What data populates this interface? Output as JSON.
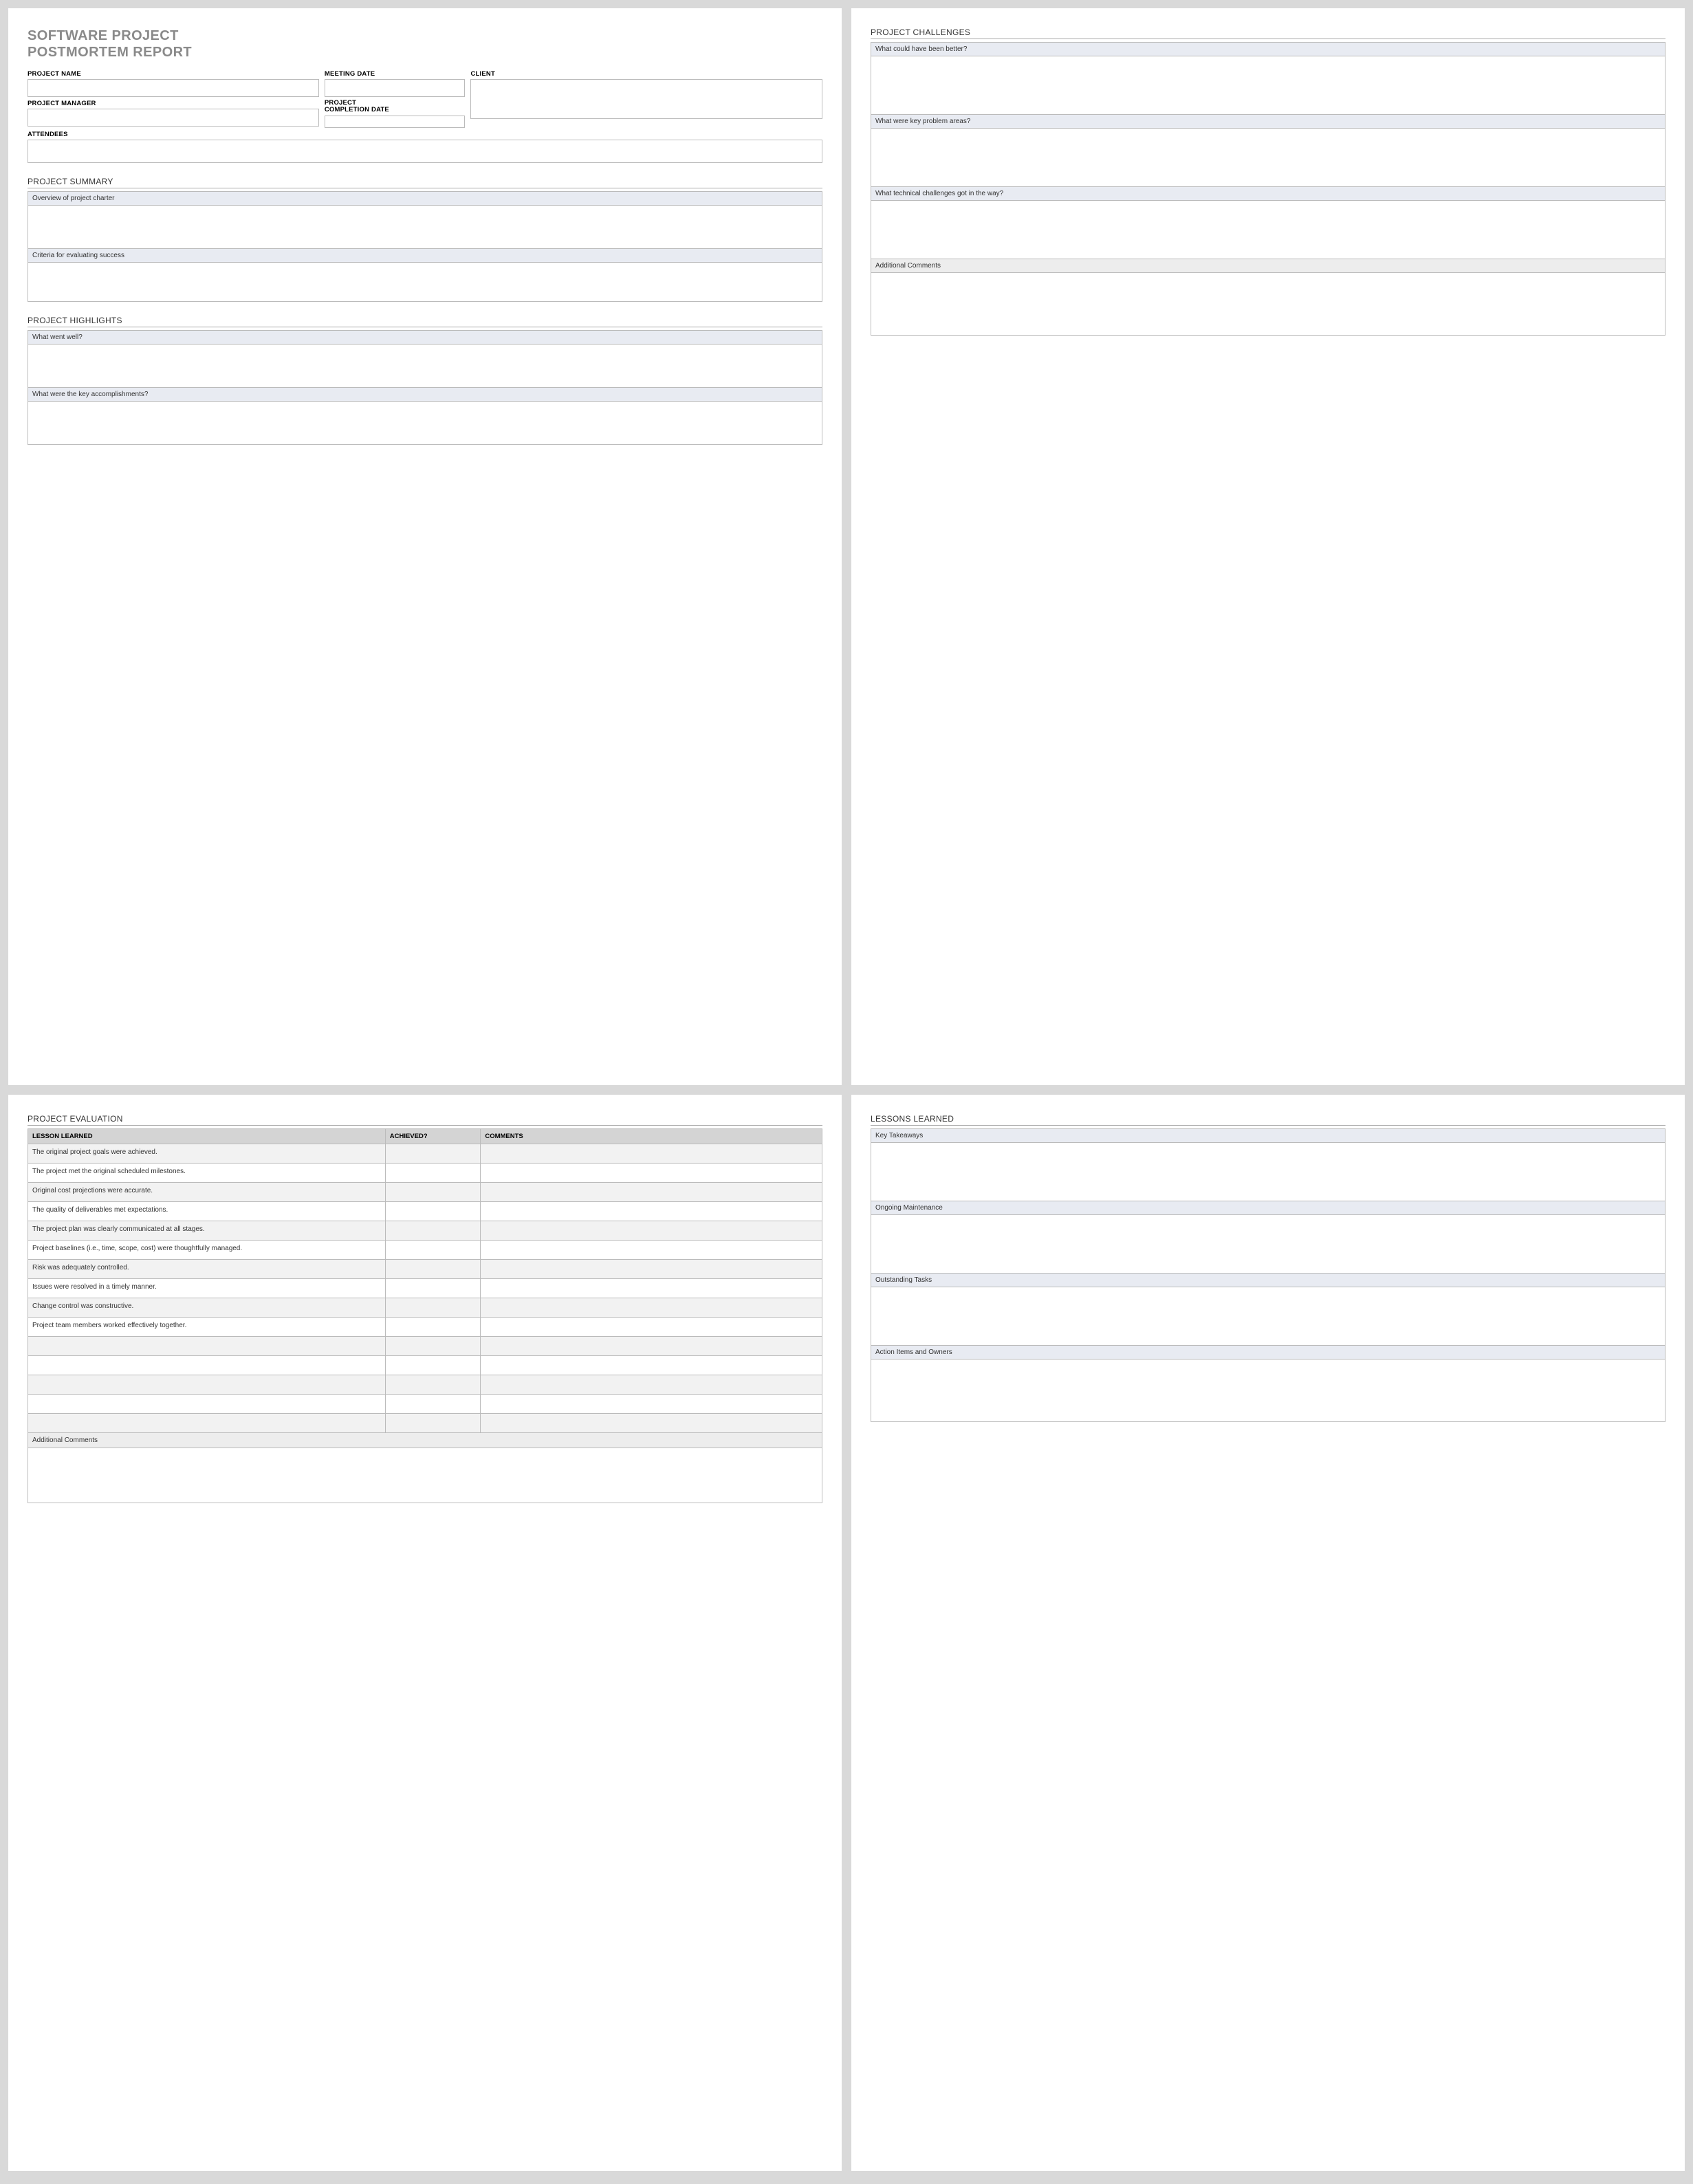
{
  "title_line1": "SOFTWARE PROJECT",
  "title_line2": "POSTMORTEM REPORT",
  "meta": {
    "project_name_label": "PROJECT NAME",
    "meeting_date_label": "MEETING DATE",
    "client_label": "CLIENT",
    "project_manager_label": "PROJECT MANAGER",
    "completion_date_label_line1": "PROJECT",
    "completion_date_label_line2": "COMPLETION DATE",
    "attendees_label": "ATTENDEES"
  },
  "summary": {
    "header": "PROJECT SUMMARY",
    "overview_label": "Overview of project charter",
    "criteria_label": "Criteria for evaluating success"
  },
  "highlights": {
    "header": "PROJECT HIGHLIGHTS",
    "went_well_label": "What went well?",
    "accomplishments_label": "What were the key accomplishments?"
  },
  "challenges": {
    "header": "PROJECT CHALLENGES",
    "better_label": "What could have been better?",
    "problem_areas_label": "What were key problem areas?",
    "technical_label": "What technical challenges got in the way?",
    "additional_label": "Additional Comments"
  },
  "evaluation": {
    "header": "PROJECT EVALUATION",
    "col_lesson": "LESSON LEARNED",
    "col_achieved": "ACHIEVED?",
    "col_comments": "COMMENTS",
    "rows": [
      "The original project goals were achieved.",
      "The project met the original scheduled milestones.",
      "Original cost projections were accurate.",
      "The quality of deliverables met expectations.",
      "The project plan was clearly communicated at all stages.",
      "Project baselines (i.e., time, scope, cost) were thoughtfully managed.",
      "Risk was adequately controlled.",
      "Issues were resolved in a timely manner.",
      "Change control was constructive.",
      "Project team members worked effectively together.",
      "",
      "",
      "",
      "",
      ""
    ],
    "additional_label": "Additional Comments"
  },
  "lessons": {
    "header": "LESSONS LEARNED",
    "key_takeaways_label": "Key Takeaways",
    "ongoing_label": "Ongoing Maintenance",
    "outstanding_label": "Outstanding Tasks",
    "action_items_label": "Action Items and Owners"
  }
}
